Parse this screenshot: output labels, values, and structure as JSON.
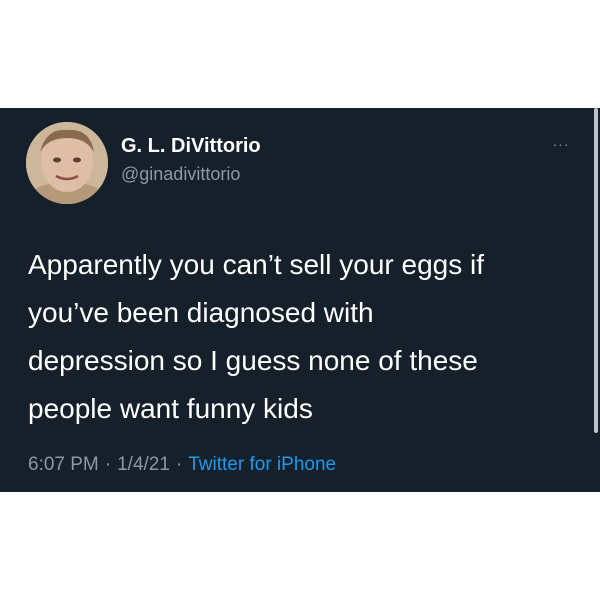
{
  "tweet": {
    "author": {
      "display_name": "G. L. DiVittorio",
      "handle": "@ginadivittorio"
    },
    "more_icon": "more-dots-icon",
    "more_label": "···",
    "text_lines": [
      "Apparently you can’t sell your eggs if",
      "you’ve been diagnosed with",
      "depression so I guess none of these",
      "people want funny kids"
    ],
    "time": "6:07 PM",
    "date": "1/4/21",
    "separator": "·",
    "source": "Twitter for iPhone"
  },
  "colors": {
    "card_background": "#15202b",
    "page_background": "#ffffff",
    "text_primary": "#ffffff",
    "text_secondary": "#8b98a5",
    "link": "#1d9bf0"
  }
}
